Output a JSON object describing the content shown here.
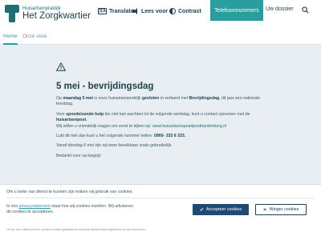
{
  "header": {
    "logo_small": "Huisartsenpraktijk",
    "logo_big": "Het Zorgkwartier",
    "translate_label": "Translate",
    "translate_icon_text": "文A",
    "read_aloud_label": "Lees voor",
    "contrast_label": "Contrast",
    "phone_button": "Telefoonnummers",
    "dossier_button": "Uw dossier",
    "icons": {
      "translate": "translate-icon",
      "read_aloud": "speaker-icon",
      "contrast": "contrast-icon",
      "search": "search-icon"
    },
    "accent_color": "#2a9d9f"
  },
  "tabs": [
    {
      "label": "Home",
      "active": true
    },
    {
      "label": "Onze visie",
      "active": false
    }
  ],
  "main": {
    "icon": "warning-icon",
    "title": "5 mei - bevrijdingsdag",
    "p1": {
      "a": "Op ",
      "b": "maandag 5 mei",
      "c": " is onze huisartsenpraktijk ",
      "d": "gesloten",
      "e": " in verband met ",
      "f": "Bevrijdingsdag",
      "g": ", dit jaar een nationale feestdag."
    },
    "p2": {
      "a": "Voor ",
      "b": "spoedeisende hulp",
      "c": " die niet kan wachten tot de volgende werkdag, kunt u contact opnemen met de ",
      "d": "huisartsenpost",
      "e": ".",
      "f": "Wij willen u vriendelijk vragen om eerst te kijken op: ",
      "g": "www.huisartsenspoedposthardenberg.nl"
    },
    "p3": {
      "a": "Lukt dit niet dan kunt u het volgende nummer bellen: ",
      "b": "0900- 333 6 333."
    },
    "p4": "Vanaf dinsdag 6 mei zijn wij weer bereikbaar zoals gebruikelijk.",
    "p5": "Bedankt voor uw begrip!"
  },
  "cookie": {
    "title": "Om u beter van dienst te kunnen zijn maken wij gebruik van cookies.",
    "body_a": "In ons ",
    "body_link": "privacystatement",
    "body_b": " staat hoe wij cookies inzetten. Wij adviseren de cookies te accepteren.",
    "accept": "Accepteer cookies",
    "reject": "Weiger cookies",
    "footer": "Let op: als u akkoord bent, worden cookies geplaatst en wordt de website beter afgestemd op uw voorkeuren."
  }
}
